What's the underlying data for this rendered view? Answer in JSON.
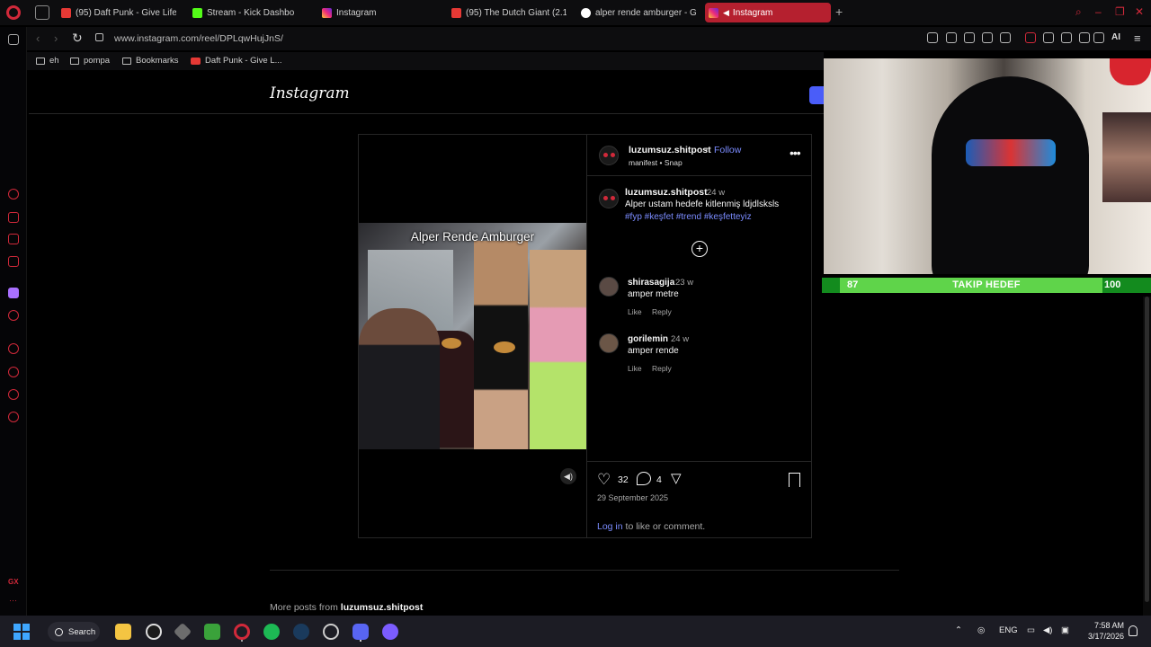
{
  "browser": {
    "tabs": [
      {
        "label": "(95) Daft Punk - Give Life"
      },
      {
        "label": "Stream - Kick Dashbo"
      },
      {
        "label": "Instagram"
      },
      {
        "label": "(95) The Dutch Giant (2.1"
      },
      {
        "label": "alper rende amburger - G"
      },
      {
        "label": "Instagram"
      }
    ],
    "url": "www.instagram.com/reel/DPLqwHujJnS/",
    "ai_label": "AI",
    "bookmarks": [
      {
        "label": "eh"
      },
      {
        "label": "pompa"
      },
      {
        "label": "Bookmarks"
      },
      {
        "label": "Daft Punk - Give L..."
      }
    ],
    "sidebar_label": "GX"
  },
  "instagram": {
    "logo": "Instagram",
    "post": {
      "video_caption": "Alper Rende Amburger",
      "username": "luzumsuz.shitpost",
      "follow_label": "Follow",
      "audio": "manifest • Snap",
      "caption_time": "24 w",
      "caption_text": "Alper ustam hedefe kitlenmiş ldjdlsksls",
      "tags": "#fyp #keşfet #trend #keşfetteyiz",
      "comments": [
        {
          "user": "shirasagija",
          "time": "23 w",
          "text": "amper metre",
          "like": "Like",
          "reply": "Reply"
        },
        {
          "user": "gorilemin",
          "time": "24 w",
          "text": "amper rende",
          "like": "Like",
          "reply": "Reply"
        }
      ],
      "likes_count": "32",
      "comments_count": "4",
      "date": "29 September 2025",
      "login_link": "Log in",
      "login_suffix": " to like or comment."
    },
    "more_posts_prefix": "More posts from ",
    "more_posts_user": "luzumsuz.shitpost"
  },
  "stream_overlay": {
    "goal_current": "87",
    "goal_title": "TAKIP HEDEF",
    "goal_target": "100"
  },
  "taskbar": {
    "search_label": "Search",
    "language": "ENG",
    "time": "7:58 AM",
    "date": "3/17/2026"
  }
}
